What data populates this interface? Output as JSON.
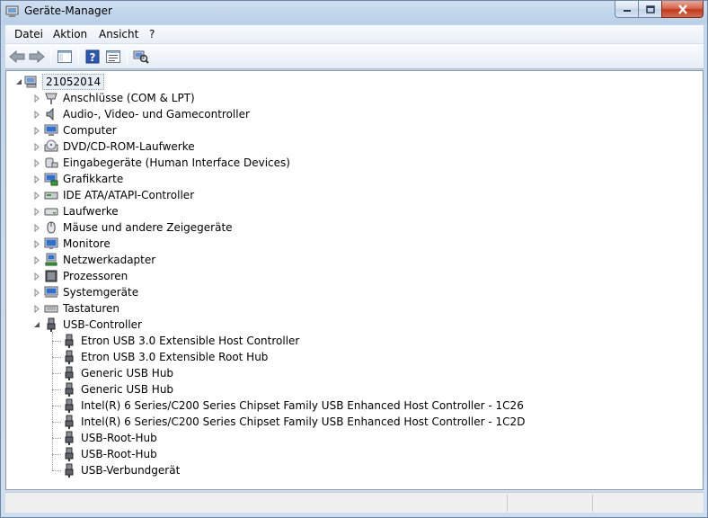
{
  "window": {
    "title": "Geräte-Manager"
  },
  "menubar": {
    "items": [
      "Datei",
      "Aktion",
      "Ansicht",
      "?"
    ]
  },
  "toolbar": {
    "buttons": [
      "back-arrow-icon",
      "forward-arrow-icon",
      "show-hide-console-tree-icon",
      "help-icon",
      "properties-icon",
      "scan-hardware-changes-icon"
    ]
  },
  "tree": {
    "root": "21052014",
    "categories": [
      {
        "label": "Anschlüsse (COM & LPT)",
        "icon": "port-icon"
      },
      {
        "label": "Audio-, Video- und Gamecontroller",
        "icon": "speaker-icon"
      },
      {
        "label": "Computer",
        "icon": "computer-icon"
      },
      {
        "label": "DVD/CD-ROM-Laufwerke",
        "icon": "dvd-drive-icon"
      },
      {
        "label": "Eingabegeräte (Human Interface Devices)",
        "icon": "hid-icon"
      },
      {
        "label": "Grafikkarte",
        "icon": "display-adapter-icon"
      },
      {
        "label": "IDE ATA/ATAPI-Controller",
        "icon": "ide-controller-icon"
      },
      {
        "label": "Laufwerke",
        "icon": "disk-drive-icon"
      },
      {
        "label": "Mäuse und andere Zeigegeräte",
        "icon": "mouse-icon"
      },
      {
        "label": "Monitore",
        "icon": "monitor-icon"
      },
      {
        "label": "Netzwerkadapter",
        "icon": "network-adapter-icon"
      },
      {
        "label": "Prozessoren",
        "icon": "processor-icon"
      },
      {
        "label": "Systemgeräte",
        "icon": "system-devices-icon"
      },
      {
        "label": "Tastaturen",
        "icon": "keyboard-icon"
      }
    ],
    "usb": {
      "label": "USB-Controller",
      "children": [
        "Etron USB 3.0 Extensible Host Controller",
        "Etron USB 3.0 Extensible Root Hub",
        "Generic USB Hub",
        "Generic USB Hub",
        "Intel(R) 6 Series/C200 Series Chipset Family USB Enhanced Host Controller - 1C26",
        "Intel(R) 6 Series/C200 Series Chipset Family USB Enhanced Host Controller - 1C2D",
        "USB-Root-Hub",
        "USB-Root-Hub",
        "USB-Verbundgerät"
      ]
    }
  },
  "colors": {
    "title_gradient_top": "#cfdff0",
    "close_button": "#c2391e",
    "tree_background": "#ffffff"
  }
}
